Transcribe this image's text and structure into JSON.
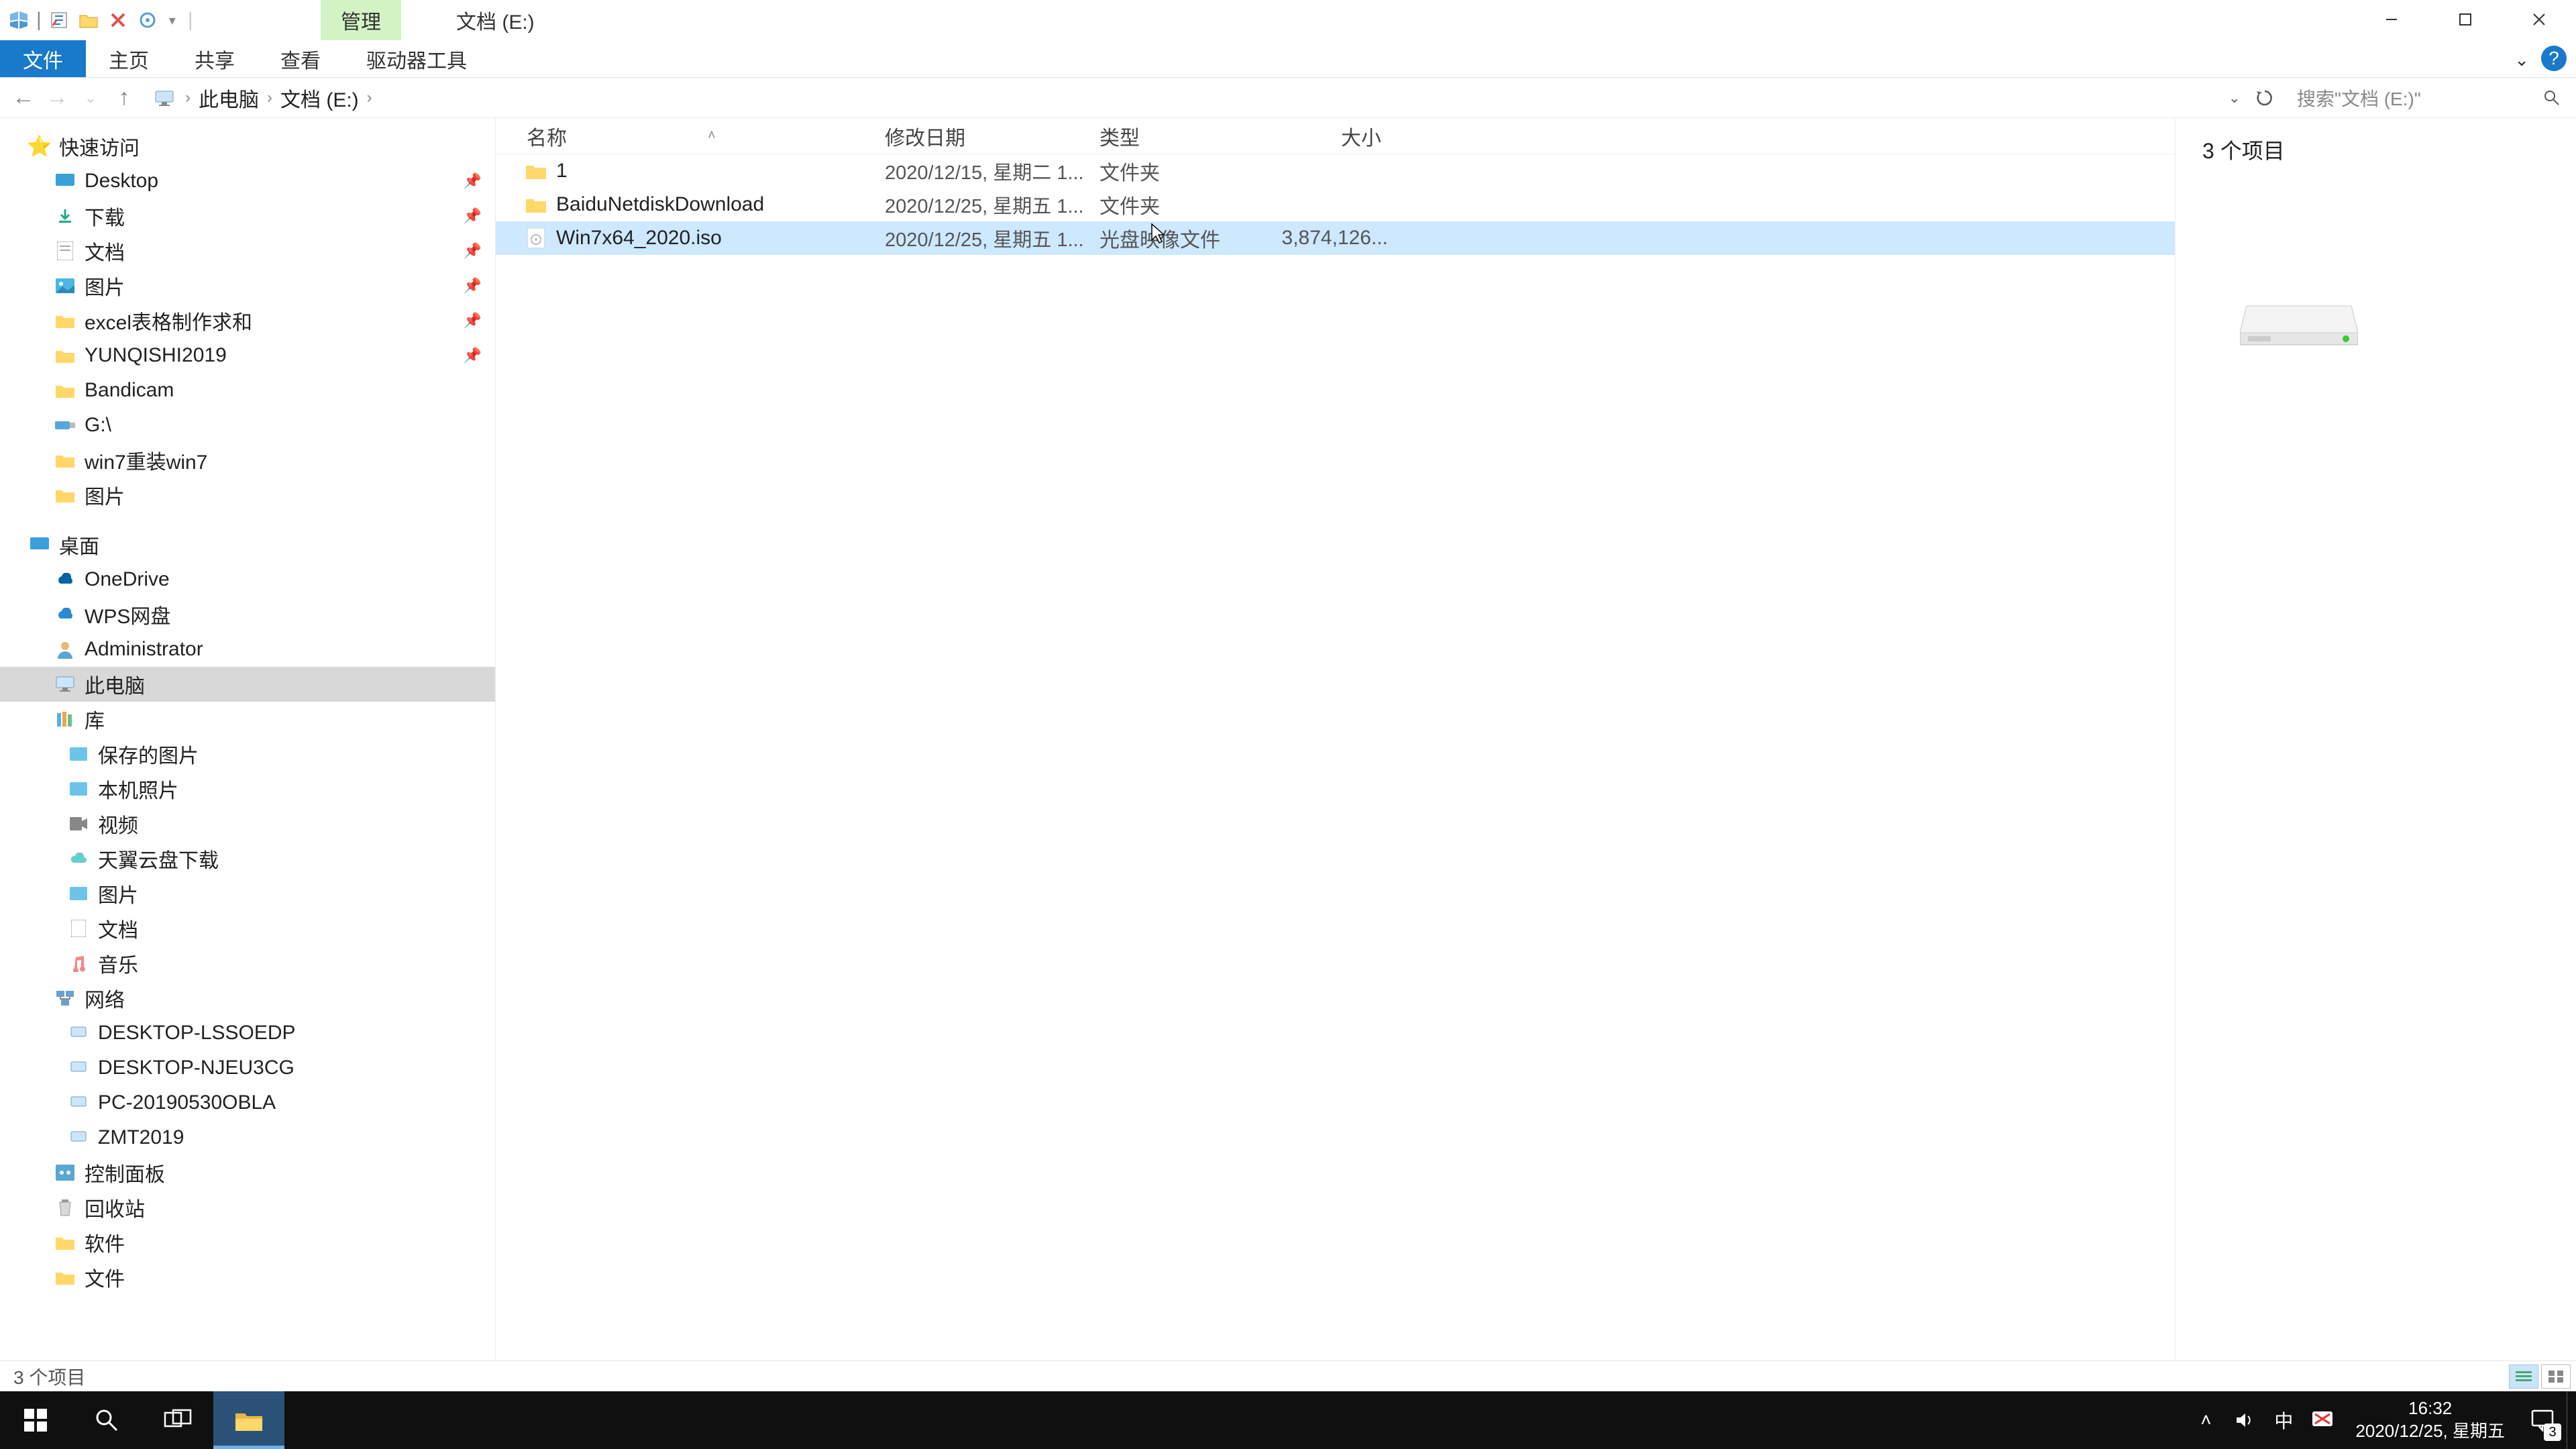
{
  "title": {
    "context_tab": "管理",
    "location": "文档 (E:)"
  },
  "ribbon": {
    "file": "文件",
    "home": "主页",
    "share": "共享",
    "view": "查看",
    "drivetools": "驱动器工具"
  },
  "breadcrumbs": {
    "root": "此电脑",
    "drive": "文档 (E:)"
  },
  "search": {
    "placeholder": "搜索\"文档 (E:)\""
  },
  "tree": {
    "quick": "快速访问",
    "desktop": "Desktop",
    "downloads": "下载",
    "docs": "文档",
    "pics": "图片",
    "excel": "excel表格制作求和",
    "yunqishi": "YUNQISHI2019",
    "bandicam": "Bandicam",
    "g": "G:\\",
    "win7": "win7重装win7",
    "pics2": "图片",
    "desktop_cn": "桌面",
    "onedrive": "OneDrive",
    "wps": "WPS网盘",
    "admin": "Administrator",
    "thispc": "此电脑",
    "lib": "库",
    "saved": "保存的图片",
    "camroll": "本机照片",
    "videos": "视频",
    "tianyi": "天翼云盘下载",
    "pics3": "图片",
    "docs2": "文档",
    "music": "音乐",
    "network": "网络",
    "pc1": "DESKTOP-LSSOEDP",
    "pc2": "DESKTOP-NJEU3CG",
    "pc3": "PC-20190530OBLA",
    "pc4": "ZMT2019",
    "control": "控制面板",
    "recycle": "回收站",
    "soft": "软件",
    "files": "文件"
  },
  "columns": {
    "name": "名称",
    "date": "修改日期",
    "type": "类型",
    "size": "大小"
  },
  "rows": [
    {
      "name": "1",
      "date": "2020/12/15, 星期二 1...",
      "type": "文件夹",
      "size": "",
      "icon": "folder"
    },
    {
      "name": "BaiduNetdiskDownload",
      "date": "2020/12/25, 星期五 1...",
      "type": "文件夹",
      "size": "",
      "icon": "folder"
    },
    {
      "name": "Win7x64_2020.iso",
      "date": "2020/12/25, 星期五 1...",
      "type": "光盘映像文件",
      "size": "3,874,126...",
      "icon": "iso",
      "sel": true
    }
  ],
  "preview": {
    "count": "3 个项目"
  },
  "status": {
    "text": "3 个项目"
  },
  "clock": {
    "time": "16:32",
    "date": "2020/12/25, 星期五"
  },
  "ime": "中",
  "notif_badge": "3"
}
